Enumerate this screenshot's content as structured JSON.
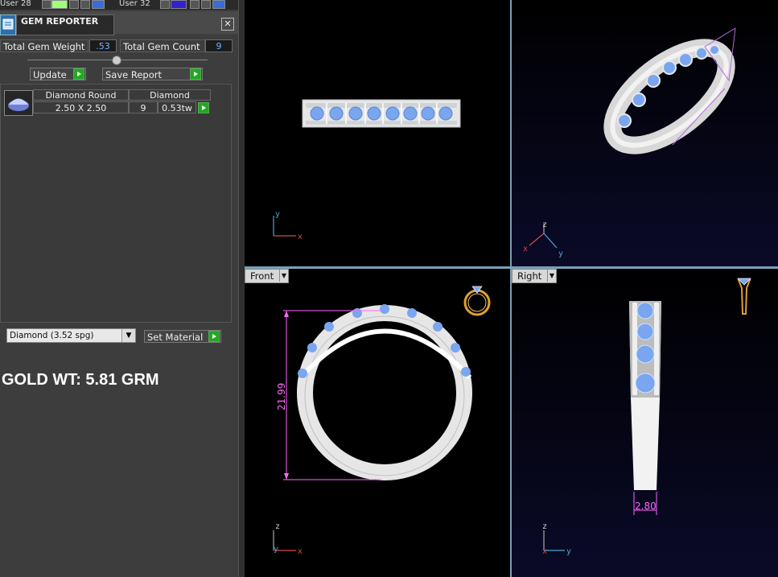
{
  "top_strip": {
    "user_left": "User 28",
    "user_right": "User 32"
  },
  "gem_reporter": {
    "title": "GEM REPORTER",
    "close_glyph": "✕",
    "total_gem_weight_label": "Total Gem Weight",
    "total_gem_weight_value": ".53",
    "total_gem_count_label": "Total Gem Count",
    "total_gem_count_value": "9",
    "update_label": "Update",
    "save_report_label": "Save Report",
    "table": {
      "header_shape": "Diamond Round",
      "header_material": "Diamond",
      "row_size": "2.50 X 2.50",
      "row_count": "9",
      "row_weight": "0.53tw"
    },
    "material_select": "Diamond     (3.52 spg)",
    "set_material_label": "Set Material",
    "gold_weight": "GOLD WT: 5.81 GRM"
  },
  "viewports": {
    "top": {
      "axis_h": "x",
      "axis_v": "y"
    },
    "perspective": {
      "axis_z": "z",
      "axis_x": "x",
      "axis_y": "y"
    },
    "front": {
      "tab_label": "Front",
      "dimension": "21.99",
      "axis_v": "z",
      "axis_h": "x",
      "axis_o": "y"
    },
    "right": {
      "tab_label": "Right",
      "dimension": "2.80",
      "axis_v": "z",
      "axis_h": "y",
      "axis_o": "x"
    }
  },
  "colors": {
    "gem_blue": "#7aa6f0",
    "metal_white": "#e4e4e4",
    "dimension_magenta": "#ff66ff",
    "panel_bg": "#3d3d3d",
    "value_blue": "#6fb4ff",
    "action_green": "#22a822"
  },
  "icons": [
    "gem-reporter-icon",
    "close-icon",
    "update-arrow-icon",
    "save-report-arrow-icon",
    "gem-row-arrow-icon",
    "dropdown-arrow-icon",
    "set-material-arrow-icon",
    "ring-gold-icon",
    "ring-profile-icon"
  ]
}
